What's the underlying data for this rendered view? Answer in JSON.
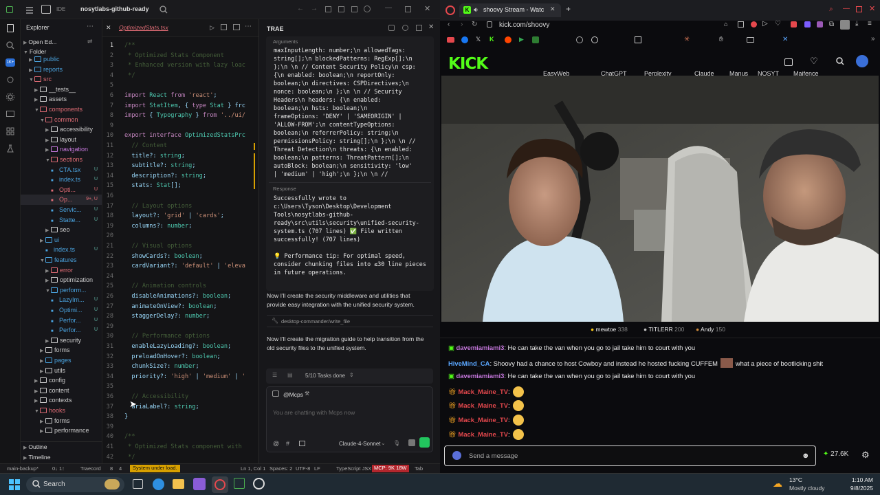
{
  "ide": {
    "app_label": "IDE",
    "project": "nosytlabs-github-ready",
    "explorer": {
      "title": "Explorer",
      "open_editors": "Open Ed...",
      "folder": "Folder",
      "tree": [
        {
          "label": "public",
          "color": "#4aa3df"
        },
        {
          "label": "reports",
          "color": "#4aa3df"
        },
        {
          "label": "src",
          "color": "#e06c75"
        },
        {
          "label": "__tests__",
          "color": "#cccccc"
        },
        {
          "label": "assets",
          "color": "#cccccc"
        },
        {
          "label": "components",
          "color": "#e06c75"
        },
        {
          "label": "common",
          "color": "#e06c75"
        },
        {
          "label": "accessibility",
          "color": "#cccccc"
        },
        {
          "label": "layout",
          "color": "#cccccc"
        },
        {
          "label": "navigation",
          "color": "#c678dd"
        },
        {
          "label": "sections",
          "color": "#e06c75"
        },
        {
          "label": "CTA.tsx",
          "color": "#4aa3df",
          "badge": "U"
        },
        {
          "label": "index.ts",
          "color": "#4aa3df",
          "badge": "U"
        },
        {
          "label": "Opti...",
          "color": "#e06c75",
          "badge": "U"
        },
        {
          "label": "Op...",
          "color": "#e06c75",
          "badge": "9+, U"
        },
        {
          "label": "Servic...",
          "color": "#4aa3df",
          "badge": "U"
        },
        {
          "label": "Statte...",
          "color": "#4aa3df",
          "badge": "U"
        },
        {
          "label": "seo",
          "color": "#cccccc"
        },
        {
          "label": "ui",
          "color": "#4aa3df"
        },
        {
          "label": "index.ts",
          "color": "#4aa3df",
          "badge": "U"
        },
        {
          "label": "features",
          "color": "#4aa3df"
        },
        {
          "label": "error",
          "color": "#e06c75"
        },
        {
          "label": "optimization",
          "color": "#cccccc"
        },
        {
          "label": "perform...",
          "color": "#4aa3df"
        },
        {
          "label": "LazyIm...",
          "color": "#4aa3df",
          "badge": "U"
        },
        {
          "label": "Optimi...",
          "color": "#4aa3df",
          "badge": "U"
        },
        {
          "label": "Perfor...",
          "color": "#4aa3df",
          "badge": "U"
        },
        {
          "label": "Perfor...",
          "color": "#4aa3df",
          "badge": "U"
        },
        {
          "label": "security",
          "color": "#cccccc"
        },
        {
          "label": "forms",
          "color": "#cccccc"
        },
        {
          "label": "pages",
          "color": "#4aa3df"
        },
        {
          "label": "utils",
          "color": "#cccccc"
        },
        {
          "label": "config",
          "color": "#cccccc"
        },
        {
          "label": "content",
          "color": "#cccccc"
        },
        {
          "label": "contexts",
          "color": "#cccccc"
        },
        {
          "label": "hooks",
          "color": "#e06c75"
        },
        {
          "label": "forms",
          "color": "#cccccc"
        },
        {
          "label": "performance",
          "color": "#cccccc"
        }
      ],
      "outline": "Outline",
      "timeline": "Timeline"
    },
    "editor_tab": "OptimizedStats.tsx",
    "code_lines": [
      "/**",
      " * Optimized Stats Component",
      " * Enhanced version with lazy loac",
      " */",
      "",
      "import React from 'react';",
      "import StatItem, { type Stat } frc",
      "import { Typography } from '../ui/",
      "",
      "export interface OptimizedStatsPrc",
      "  // Content",
      "  title?: string;",
      "  subtitle?: string;",
      "  description?: string;",
      "  stats: Stat[];",
      "",
      "  // Layout options",
      "  layout?: 'grid' | 'cards';",
      "  columns?: number;",
      "",
      "  // Visual options",
      "  showCards?: boolean;",
      "  cardVariant?: 'default' | 'eleva",
      "",
      "  // Animation controls",
      "  disableAnimations?: boolean;",
      "  animateOnView?: boolean;",
      "  staggerDelay?: number;",
      "",
      "  // Performance options",
      "  enableLazyLoading?: boolean;",
      "  preloadOnHover?: boolean;",
      "  chunkSize?: number;",
      "  priority?: 'high' | 'medium' | '",
      "",
      "  // Accessibility",
      "  ariaLabel?: string;",
      "}",
      "",
      "/**",
      " * Optimized Stats component with",
      " */"
    ],
    "status": {
      "branch": "main-backup*",
      "sync": "0↓ 1↑",
      "traecord": "Traecord",
      "problems": "8",
      "warnings": "4",
      "load": "System under load.",
      "position": "Ln 1, Col 1",
      "spaces": "Spaces: 2",
      "encoding": "UTF-8",
      "eol": "LF",
      "language": "TypeScript JSX",
      "mcp": "MCP: 9K 18W",
      "tab": "Tab"
    }
  },
  "trae": {
    "title": "TRAE",
    "arguments_label": "Arguments",
    "arguments_lines": [
      "maxInputLength: number;\\n   allowedTags:",
      "string[];\\n    blockedPatterns: RegExp[];\\n",
      "};\\n  \\n  // Content Security Policy\\n  csp:",
      "{\\n    enabled: boolean;\\n    reportOnly:",
      "boolean;\\n    directives: CSPDirectives;\\n",
      "nonce: boolean;\\n  };\\n  \\n  // Security",
      "Headers\\n  headers: {\\n    enabled:",
      "boolean;\\n    hsts: boolean;\\n",
      "frameOptions: 'DENY' | 'SAMEORIGIN' |",
      "'ALLOW-FROM';\\n    contentTypeOptions:",
      "boolean;\\n    referrerPolicy: string;\\n",
      "permissionsPolicy: string[];\\n  };\\n  \\n  //",
      "Threat Detection\\n  threats: {\\n    enabled:",
      "boolean;\\n    patterns: ThreatPattern[];\\n",
      "autoBlock: boolean;\\n    sensitivity: 'low'",
      "| 'medium' | 'high';\\n  };\\n  \\n  //"
    ],
    "response_label": "Response",
    "response_lines": [
      "Successfully wrote to",
      "c:\\Users\\Tyson\\Desktop\\Development",
      "Tools\\nosytlabs-github-",
      "ready\\src\\utils\\security\\unified-security-",
      "system.ts (707 lines) ✅ File written",
      "successfully! (707 lines)"
    ],
    "tip_lines": [
      "💡 Performance tip: For optimal speed,",
      "consider chunking files into ≤30 line pieces",
      "in future operations."
    ],
    "msg1_lines": [
      "Now I'll create the security middleware and utilities that",
      "provide easy integration with the unified security system."
    ],
    "tool_chip": "desktop-commander/write_file",
    "msg2_lines": [
      "Now I'll create the migration guide to help transition from the",
      "old security files to the unified system."
    ],
    "tasks": "5/10 Tasks done",
    "agent": "@Mcps",
    "input_placeholder": "You are chatting with Mcps now",
    "model": "Claude-4-Sonnet"
  },
  "browser": {
    "tab_title": "shoovy Stream - Watc",
    "url": "kick.com/shoovy",
    "bookmarks": [
      "EasyWeb",
      "ChatGPT",
      "Perplexity",
      "Claude",
      "Manus",
      "NOSYT",
      "Maifence"
    ],
    "site_logo": "KICK",
    "gifters": [
      {
        "name": "mewtoe",
        "count": "338",
        "color": "#f5c518"
      },
      {
        "name": "TITLERR",
        "count": "200",
        "color": "#c0c0c0"
      },
      {
        "name": "Andy",
        "count": "150",
        "color": "#d08a3a"
      }
    ],
    "chat": [
      {
        "user": "davemiamiami3",
        "color": "#c678dd",
        "text": "He can take the van when you go to jail take him to court with you",
        "badge": "mod"
      },
      {
        "user": "HiveMind_CA",
        "color": "#5aa7ff",
        "text": "Shoovy had a chance to host Cowboy and instead he hosted fucking CUFFEM",
        "suffix": "what a piece of bootlicking shit",
        "badge": "none"
      },
      {
        "user": "davemiamiami3",
        "color": "#c678dd",
        "text": "He can take the van when you go to jail take him to court with you",
        "badge": "mod"
      },
      {
        "user": "Mack_Maine_TV",
        "color": "#e5484d",
        "text": "",
        "badge": "gift"
      },
      {
        "user": "Mack_Maine_TV",
        "color": "#e5484d",
        "text": "",
        "badge": "gift"
      },
      {
        "user": "Mack_Maine_TV",
        "color": "#e5484d",
        "text": "",
        "badge": "gift"
      },
      {
        "user": "Mack_Maine_TV",
        "color": "#e5484d",
        "text": "",
        "badge": "gift"
      }
    ],
    "send_placeholder": "Send a message",
    "viewers": "27.6K",
    "accent": "#53fc18"
  },
  "taskbar": {
    "search": "Search",
    "temp": "13°C",
    "weather": "Mostly cloudy",
    "time": "1:10 AM",
    "date": "9/8/2025"
  }
}
